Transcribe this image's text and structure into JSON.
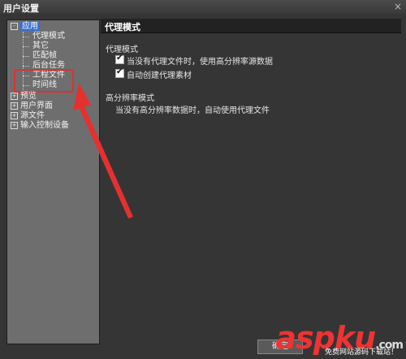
{
  "window": {
    "title": "用户设置",
    "close_glyph": "×"
  },
  "tree": {
    "root_selected": "应用",
    "children": [
      "代理模式",
      "其它",
      "匹配帧",
      "后台任务",
      "工程文件",
      "时间线"
    ],
    "siblings": [
      "预览",
      "用户界面",
      "源文件",
      "输入控制设备"
    ],
    "expand_glyph": "+",
    "collapse_glyph": "-"
  },
  "panel": {
    "header": "代理模式",
    "section1": "代理模式",
    "option1": "当没有代理文件时，使用高分辨率源数据",
    "option1_checked": true,
    "option2": "自动创建代理素材",
    "option2_checked": true,
    "section2": "高分辨率模式",
    "section2_desc": "当没有高分辨率数据时，自动使用代理文件"
  },
  "footer": {
    "ok_label": "确定"
  },
  "watermark": {
    "brand": "aspku",
    "suffix": ".com",
    "tagline": "免费网站源码下载站！"
  }
}
